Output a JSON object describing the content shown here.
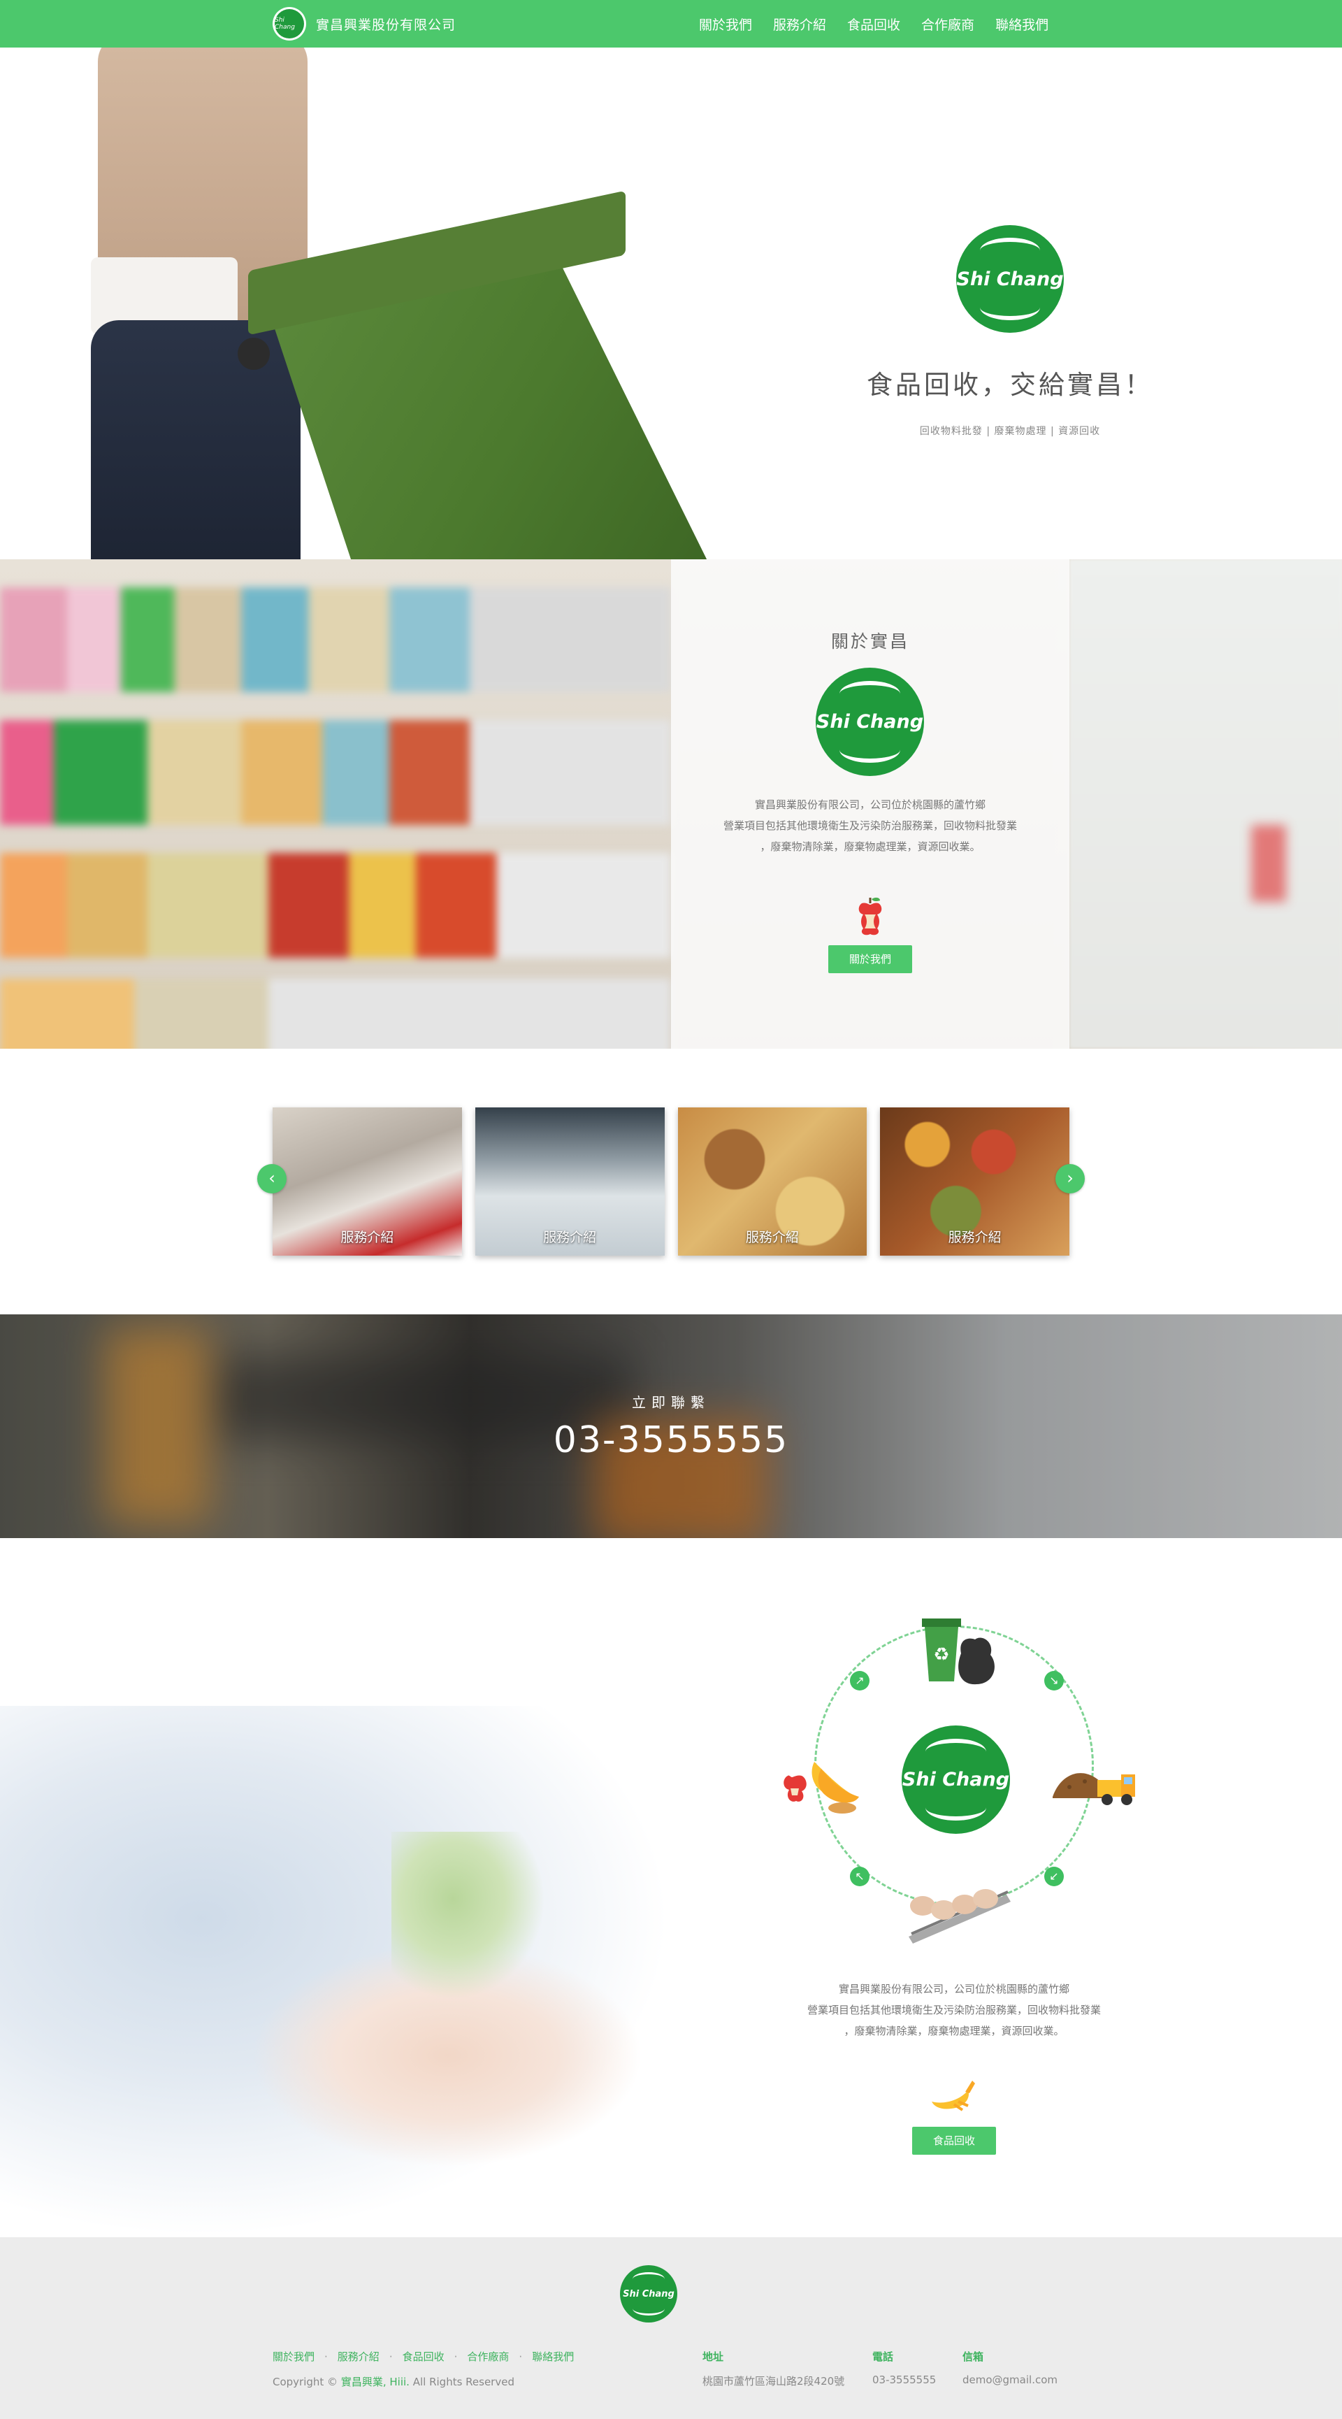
{
  "header": {
    "brand_logo_text": "Shi Chang",
    "brand_name": "實昌興業股份有限公司",
    "nav": [
      "關於我們",
      "服務介紹",
      "食品回收",
      "合作廠商",
      "聯絡我們"
    ]
  },
  "hero": {
    "logo_text": "Shi Chang",
    "tagline": "食品回收，交給實昌！",
    "subline": "回收物料批發 | 廢棄物處理 | 資源回收"
  },
  "about": {
    "title": "關於實昌",
    "logo_text": "Shi Chang",
    "text_lines": [
      "實昌興業股份有限公司，公司位於桃園縣的蘆竹鄉",
      "營業項目包括其他環境衛生及污染防治服務業，回收物料批發業",
      "，廢棄物清除業，廢棄物處理業，資源回收業。"
    ],
    "apple_icon": "apple-core-icon",
    "button": "關於我們"
  },
  "services": {
    "prev_icon": "chevron-left-icon",
    "next_icon": "chevron-right-icon",
    "cards": [
      {
        "caption": "服務介紹"
      },
      {
        "caption": "服務介紹"
      },
      {
        "caption": "服務介紹"
      },
      {
        "caption": "服務介紹"
      }
    ]
  },
  "contact": {
    "label": "立即聯繫",
    "phone": "03-3555555"
  },
  "recycle": {
    "logo_text": "Shi Chang",
    "icons": [
      "recycle-bin-icon",
      "fruit-waste-icon",
      "dump-truck-icon",
      "conveyor-belt-icon"
    ],
    "text_lines": [
      "實昌興業股份有限公司，公司位於桃園縣的蘆竹鄉",
      "營業項目包括其他環境衛生及污染防治服務業，回收物料批發業",
      "，廢棄物清除業，廢棄物處理業，資源回收業。"
    ],
    "banana_icon": "banana-peel-icon",
    "button": "食品回收"
  },
  "footer": {
    "logo_text": "Shi Chang",
    "links": [
      "關於我們",
      "服務介紹",
      "食品回收",
      "合作廠商",
      "聯絡我們"
    ],
    "copyright_prefix": "Copyright ©",
    "copyright_brand": "實昌興業, Hiii.",
    "copyright_suffix": "All Rights Reserved",
    "address_label": "地址",
    "address": "桃園市蘆竹區海山路2段420號",
    "phone_label": "電話",
    "phone": "03-3555555",
    "email_label": "信箱",
    "email": "demo@gmail.com"
  },
  "colors": {
    "accent": "#4cc86c",
    "logo_green": "#1f9a3c",
    "footer_bg": "#ececec"
  }
}
